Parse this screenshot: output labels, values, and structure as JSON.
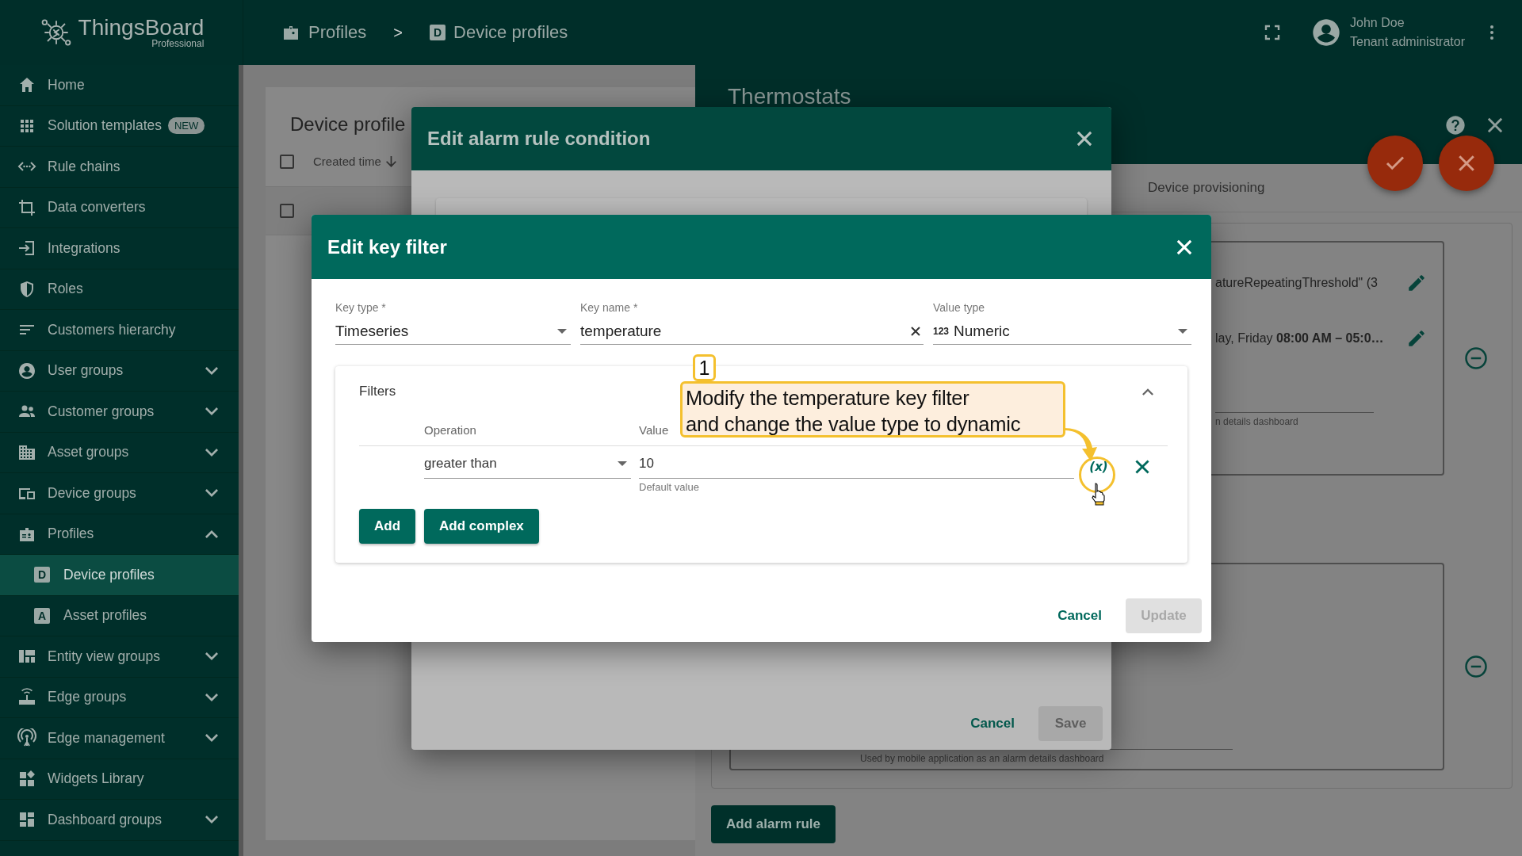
{
  "header": {
    "logo": {
      "name": "ThingsBoard",
      "edition": "Professional"
    },
    "breadcrumb": {
      "parent": "Profiles",
      "separator": ">",
      "current": "Device profiles",
      "current_icon_text": "D"
    },
    "user": {
      "name": "John Doe",
      "role": "Tenant administrator"
    }
  },
  "sidebar": {
    "items": [
      {
        "label": "Home",
        "kind": "link",
        "selected": false
      },
      {
        "label": "Solution templates",
        "kind": "link",
        "badge": "NEW",
        "selected": false
      },
      {
        "label": "Rule chains",
        "kind": "link",
        "selected": false
      },
      {
        "label": "Data converters",
        "kind": "link",
        "selected": false
      },
      {
        "label": "Integrations",
        "kind": "link",
        "selected": false
      },
      {
        "label": "Roles",
        "kind": "link",
        "selected": false
      },
      {
        "label": "Customers hierarchy",
        "kind": "link",
        "selected": false
      },
      {
        "label": "User groups",
        "kind": "group",
        "expanded": false,
        "selected": false
      },
      {
        "label": "Customer groups",
        "kind": "group",
        "expanded": false,
        "selected": false
      },
      {
        "label": "Asset groups",
        "kind": "group",
        "expanded": false,
        "selected": false
      },
      {
        "label": "Device groups",
        "kind": "group",
        "expanded": false,
        "selected": false
      },
      {
        "label": "Profiles",
        "kind": "group",
        "expanded": true,
        "selected": false,
        "children": [
          {
            "label": "Device profiles",
            "icon_text": "D",
            "selected": true
          },
          {
            "label": "Asset profiles",
            "icon_text": "A",
            "selected": false
          }
        ]
      },
      {
        "label": "Entity view groups",
        "kind": "group",
        "expanded": false,
        "selected": false
      },
      {
        "label": "Edge groups",
        "kind": "group",
        "expanded": false,
        "selected": false
      },
      {
        "label": "Edge management",
        "kind": "group",
        "expanded": false,
        "selected": false
      },
      {
        "label": "Widgets Library",
        "kind": "link",
        "selected": false
      },
      {
        "label": "Dashboard groups",
        "kind": "group",
        "expanded": false,
        "selected": false
      }
    ]
  },
  "profiles_list": {
    "title": "Device profile",
    "header_checkbox": {
      "checked": false
    },
    "columns": [
      {
        "label": "Created time",
        "sorted": true
      }
    ],
    "rows": [
      {
        "checked": false
      }
    ]
  },
  "details": {
    "title": "Thermostats",
    "tabs": [
      {
        "label": "Device provisioning",
        "selected": false
      }
    ],
    "rules": [
      {
        "condition": "atureRepeatingThreshold\" (3",
        "schedule": "lay, Friday **08:00 AM – 05:0…**",
        "hint": "n details dashboard"
      },
      {
        "hint": "Used by mobile application as an alarm details dashboard"
      }
    ],
    "add_button": "Add alarm rule"
  },
  "alarm_dialog": {
    "title": "Edit alarm rule condition",
    "cancel": "Cancel",
    "save": {
      "label": "Save",
      "disabled": true
    }
  },
  "key_filter_dialog": {
    "title": "Edit key filter",
    "fields": [
      {
        "label": "Key type *",
        "value": "Timeseries",
        "kind": "select"
      },
      {
        "label": "Key name *",
        "value": "temperature",
        "kind": "text"
      },
      {
        "label": "Value type",
        "value": "Numeric",
        "icon_text": "123",
        "kind": "select"
      }
    ],
    "filters": {
      "title": "Filters",
      "expanded": true,
      "columns": [
        "Operation",
        "Value"
      ],
      "rows": [
        {
          "operation": "greater than",
          "value": "10",
          "hint": "Default value",
          "dynamic_button": "(x)"
        }
      ],
      "buttons": [
        "Add",
        "Add complex"
      ]
    },
    "cancel": "Cancel",
    "update": {
      "label": "Update",
      "disabled": true
    }
  },
  "annotation": {
    "step": "1",
    "text": "Modify the temperature key filter\nand change the value type to dynamic"
  }
}
